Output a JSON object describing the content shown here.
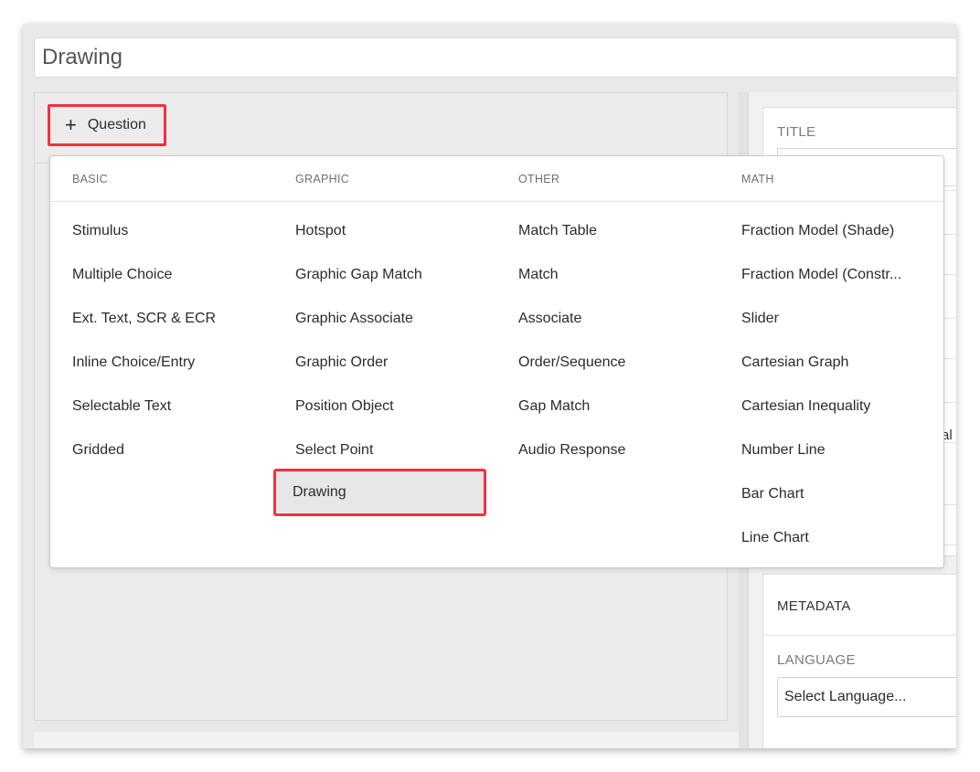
{
  "title_field": {
    "value": "Drawing"
  },
  "add_question": {
    "label": "Question",
    "icon": "plus-icon"
  },
  "dropdown": {
    "columns": [
      {
        "header": "BASIC",
        "items": [
          "Stimulus",
          "Multiple Choice",
          "Ext. Text, SCR & ECR",
          "Inline Choice/Entry",
          "Selectable Text",
          "Gridded"
        ]
      },
      {
        "header": "GRAPHIC",
        "items": [
          "Hotspot",
          "Graphic Gap Match",
          "Graphic Associate",
          "Graphic Order",
          "Position Object",
          "Select Point",
          "Drawing"
        ]
      },
      {
        "header": "OTHER",
        "items": [
          "Match Table",
          "Match",
          "Associate",
          "Order/Sequence",
          "Gap Match",
          "Audio Response"
        ]
      },
      {
        "header": "MATH",
        "items": [
          "Fraction Model (Shade)",
          "Fraction Model (Constr...",
          "Slider",
          "Cartesian Graph",
          "Cartesian Inequality",
          "Number Line",
          "Bar Chart",
          "Line Chart"
        ]
      }
    ],
    "selected": "Drawing"
  },
  "right_panel": {
    "title_label": "TITLE",
    "peek_text": "al",
    "metadata_title": "METADATA",
    "language_label": "LANGUAGE",
    "language_select": "Select Language..."
  },
  "colors": {
    "highlight": "#f0323f",
    "panel_bg": "#ececec",
    "selected_bg": "#e7e7e7"
  }
}
